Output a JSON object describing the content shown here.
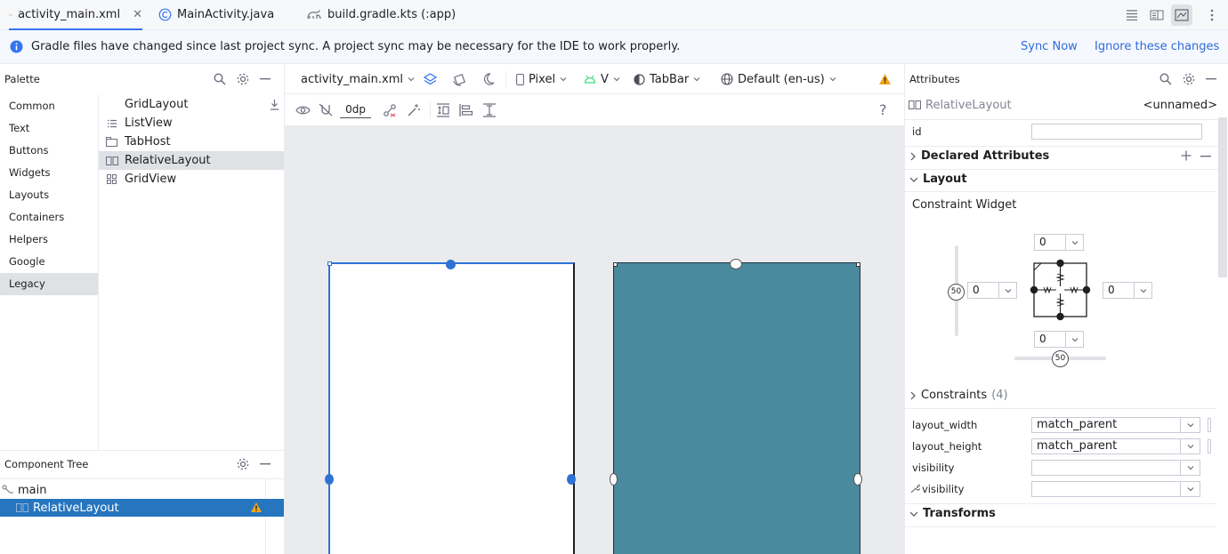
{
  "tabs": [
    {
      "label": "activity_main.xml",
      "icon": "xml-code-icon",
      "active": true
    },
    {
      "label": "MainActivity.java",
      "icon": "class-c-icon",
      "active": false
    },
    {
      "label": "build.gradle.kts (:app)",
      "icon": "gradle-elephant-icon",
      "active": false
    }
  ],
  "banner": {
    "message": "Gradle files have changed since last project sync. A project sync may be necessary for the IDE to work properly.",
    "sync_now": "Sync Now",
    "ignore": "Ignore these changes"
  },
  "palette": {
    "title": "Palette",
    "categories": [
      "Common",
      "Text",
      "Buttons",
      "Widgets",
      "Layouts",
      "Containers",
      "Helpers",
      "Google",
      "Legacy"
    ],
    "selected_category": "Legacy",
    "items": [
      "GridLayout",
      "ListView",
      "TabHost",
      "RelativeLayout",
      "GridView"
    ],
    "selected_item": "RelativeLayout"
  },
  "component_tree": {
    "title": "Component Tree",
    "rows": [
      "main",
      "RelativeLayout"
    ]
  },
  "editor": {
    "file_dropdown": "activity_main.xml",
    "device": "Pixel",
    "api": "V",
    "theme": "TabBar",
    "locale": "Default (en-us)",
    "margin": "0dp",
    "help": "?"
  },
  "attributes": {
    "title": "Attributes",
    "component": "RelativeLayout",
    "component_id": "<unnamed>",
    "id_label": "id",
    "id_value": "",
    "declared": "Declared Attributes",
    "layout": "Layout",
    "constraint_widget": "Constraint Widget",
    "margin_top": "0",
    "margin_bottom": "0",
    "margin_left": "0",
    "margin_right": "0",
    "bias_v": "50",
    "bias_h": "50",
    "constraints": "Constraints",
    "constraints_count": "(4)",
    "layout_width_label": "layout_width",
    "layout_width": "match_parent",
    "layout_height_label": "layout_height",
    "layout_height": "match_parent",
    "visibility_label": "visibility",
    "visibility": "",
    "tools_visibility_label": "visibility",
    "tools_visibility": "",
    "transforms": "Transforms"
  },
  "colors": {
    "accent": "#3574f0",
    "selection": "#2675bf",
    "blueprint_fill": "#4a8a9e",
    "warning": "#f2a51c"
  }
}
